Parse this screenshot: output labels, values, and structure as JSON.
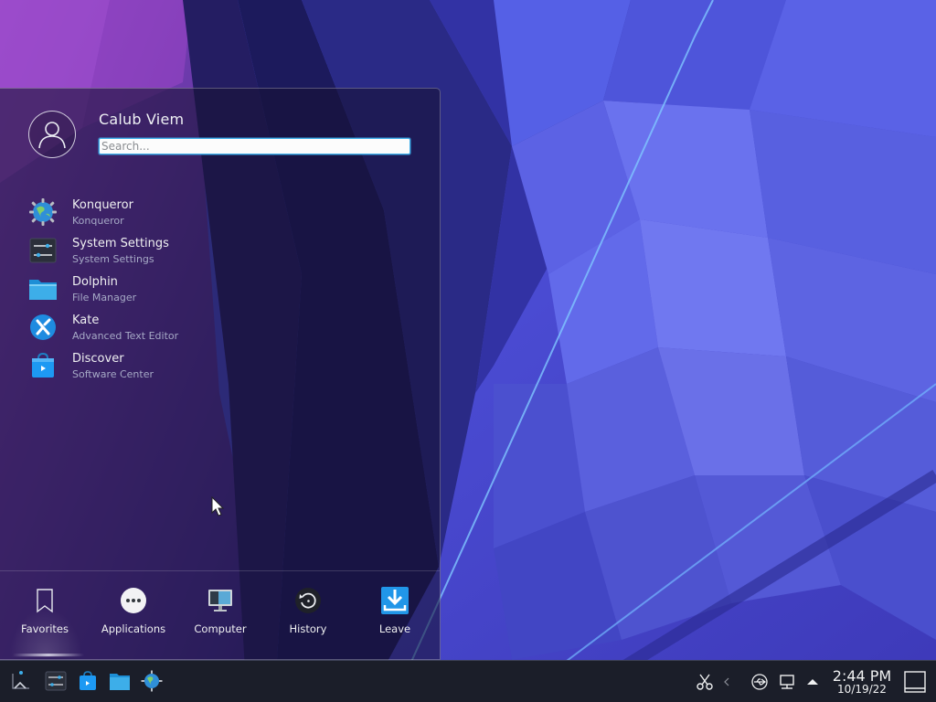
{
  "user": {
    "name": "Calub Viem"
  },
  "search": {
    "placeholder": "Search...",
    "value": ""
  },
  "favorites": [
    {
      "title": "Konqueror",
      "subtitle": "Konqueror",
      "icon": "konqueror-globe-icon"
    },
    {
      "title": "System Settings",
      "subtitle": "System Settings",
      "icon": "system-settings-icon"
    },
    {
      "title": "Dolphin",
      "subtitle": "File Manager",
      "icon": "folder-icon"
    },
    {
      "title": "Kate",
      "subtitle": "Advanced Text Editor",
      "icon": "kate-icon"
    },
    {
      "title": "Discover",
      "subtitle": "Software Center",
      "icon": "discover-bag-icon"
    }
  ],
  "tabs": [
    {
      "label": "Favorites",
      "icon": "bookmark-icon",
      "active": true
    },
    {
      "label": "Applications",
      "icon": "ellipsis-icon",
      "active": false
    },
    {
      "label": "Computer",
      "icon": "computer-icon",
      "active": false
    },
    {
      "label": "History",
      "icon": "history-icon",
      "active": false
    },
    {
      "label": "Leave",
      "icon": "leave-arrow-icon",
      "active": false
    }
  ],
  "panel": {
    "launchers": [
      "kde-launcher-icon",
      "system-settings-icon",
      "discover-bag-icon",
      "folder-icon",
      "konqueror-globe-icon"
    ],
    "tray": [
      "scissors-icon",
      "volume-icon",
      "usb-icon",
      "network-icon",
      "tray-expand-arrow-icon"
    ],
    "clock": {
      "time": "2:44 PM",
      "date": "10/19/22"
    }
  },
  "colors": {
    "accent": "#3daee9",
    "panel_bg": "#1b1e29",
    "wallpaper_blue": "#4b4fd8",
    "wallpaper_purple": "#7a3aa8"
  }
}
